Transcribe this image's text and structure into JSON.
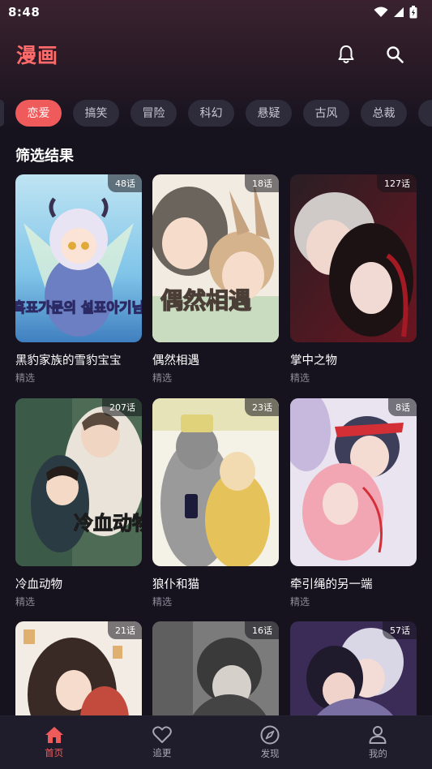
{
  "status": {
    "time": "8:48"
  },
  "app": {
    "title": "漫画"
  },
  "chips": [
    {
      "label": "恋爱",
      "active": true
    },
    {
      "label": "搞笑"
    },
    {
      "label": "冒险"
    },
    {
      "label": "科幻"
    },
    {
      "label": "悬疑"
    },
    {
      "label": "古风"
    },
    {
      "label": "总裁"
    }
  ],
  "section": {
    "title": "筛选结果"
  },
  "comics": [
    {
      "title": "黑豹家族的雪豹宝宝",
      "tag": "精选",
      "episodes": "48话",
      "cover_text": "흑표가문의 설표아기님"
    },
    {
      "title": "偶然相遇",
      "tag": "精选",
      "episodes": "18话",
      "cover_text": "偶然相遇"
    },
    {
      "title": "掌中之物",
      "tag": "精选",
      "episodes": "127话"
    },
    {
      "title": "冷血动物",
      "tag": "精选",
      "episodes": "207话",
      "cover_text": "冷血动物"
    },
    {
      "title": "狼仆和猫",
      "tag": "精选",
      "episodes": "23话"
    },
    {
      "title": "牵引绳的另一端",
      "tag": "精选",
      "episodes": "8话"
    },
    {
      "title": "",
      "tag": "",
      "episodes": "21话"
    },
    {
      "title": "",
      "tag": "",
      "episodes": "16话"
    },
    {
      "title": "",
      "tag": "",
      "episodes": "57话"
    }
  ],
  "nav": [
    {
      "label": "首页",
      "icon": "home-icon",
      "active": true
    },
    {
      "label": "追更",
      "icon": "heart-icon"
    },
    {
      "label": "发现",
      "icon": "compass-icon"
    },
    {
      "label": "我的",
      "icon": "user-icon"
    }
  ],
  "colors": {
    "accent": "#ef5b5b",
    "title": "#ff6b6b",
    "background": "#16131f",
    "chip": "#2e2c3a"
  }
}
